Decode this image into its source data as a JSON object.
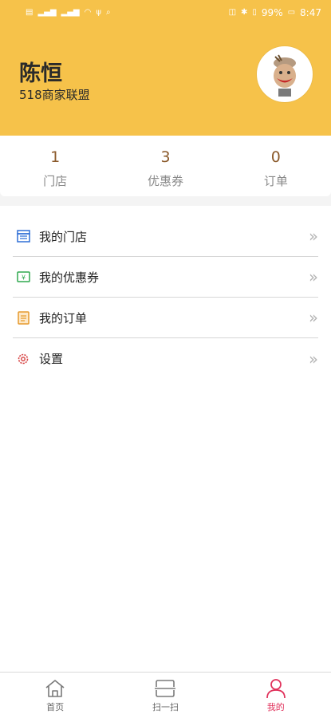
{
  "status_bar": {
    "battery": "99%",
    "time": "8:47"
  },
  "profile": {
    "name": "陈恒",
    "subtitle": "518商家联盟"
  },
  "stats": [
    {
      "value": "1",
      "label": "门店"
    },
    {
      "value": "3",
      "label": "优惠券"
    },
    {
      "value": "0",
      "label": "订单"
    }
  ],
  "menu": [
    {
      "label": "我的门店",
      "icon": "store-icon"
    },
    {
      "label": "我的优惠券",
      "icon": "coupon-icon"
    },
    {
      "label": "我的订单",
      "icon": "order-icon"
    },
    {
      "label": "设置",
      "icon": "gear-icon"
    }
  ],
  "tabs": [
    {
      "label": "首页",
      "icon": "home-icon"
    },
    {
      "label": "扫一扫",
      "icon": "scan-icon"
    },
    {
      "label": "我的",
      "icon": "person-icon",
      "active": true
    }
  ],
  "colors": {
    "header_bg": "#f6c24a",
    "stat_value": "#8b5a2b",
    "active_tab": "#e0305a"
  }
}
